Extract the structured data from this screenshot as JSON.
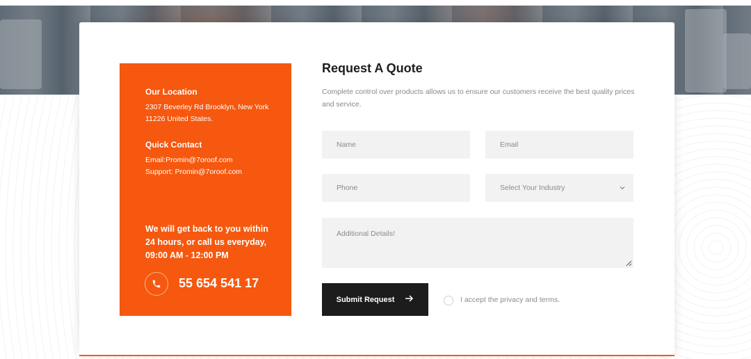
{
  "contact": {
    "location_heading": "Our Location",
    "address_line1": "2307 Beverley Rd Brooklyn, New York",
    "address_line2": "11226 United States.",
    "quick_contact_heading": "Quick Contact",
    "email": "Email:Promin@7oroof.com",
    "support": "Support: Promin@7oroof.com",
    "callback_line1": "We will get back to you within",
    "callback_line2": "24 hours, or call us everyday,",
    "callback_line3": "09:00 AM - 12:00 PM",
    "phone": "55 654 541 17",
    "phone_icon": "phone-icon"
  },
  "form": {
    "title": "Request A Quote",
    "description": "Complete control over products allows us to ensure our customers receive the best quality prices and service.",
    "name_placeholder": "Name",
    "email_placeholder": "Email",
    "phone_placeholder": "Phone",
    "industry_selected": "Select Your Industry",
    "details_placeholder": "Additional Details!",
    "submit_label": "Submit Request",
    "accept_label": "I accept the privacy and terms."
  },
  "colors": {
    "accent": "#f5580e",
    "button": "#1c1c1c",
    "field_bg": "#f2f2f2"
  }
}
